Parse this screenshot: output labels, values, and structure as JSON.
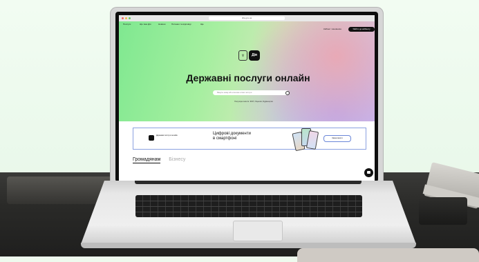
{
  "browser": {
    "url": "diia.gov.ua"
  },
  "nav": {
    "items": [
      "Послуги",
      "Що таке Дія",
      "Новини",
      "Питання та відповіді",
      "Ще"
    ],
    "login_label": "Кабінет чиновника",
    "cta_label": "Увійти до кабінету"
  },
  "hero": {
    "logo_text": "Дія",
    "title": "Державні послуги онлайн",
    "search_placeholder": "Введіть назву або ключове слово послуги",
    "subtext": "Популярні запити: ФОП, Ліцензія, Будівництво"
  },
  "banner": {
    "small_text": "Державні послуги онлайн",
    "headline_line1": "Цифрові документи",
    "headline_line2": "в смартфоні",
    "button_label": "Завантажити"
  },
  "tabs": {
    "active": "Громадянам",
    "inactive": "Бізнесу"
  },
  "colors": {
    "hero_green": "#7fe890",
    "hero_pink": "#e8a9b6",
    "hero_violet": "#b9a8ef",
    "banner_border": "#8aa0e0",
    "dark": "#111111"
  }
}
